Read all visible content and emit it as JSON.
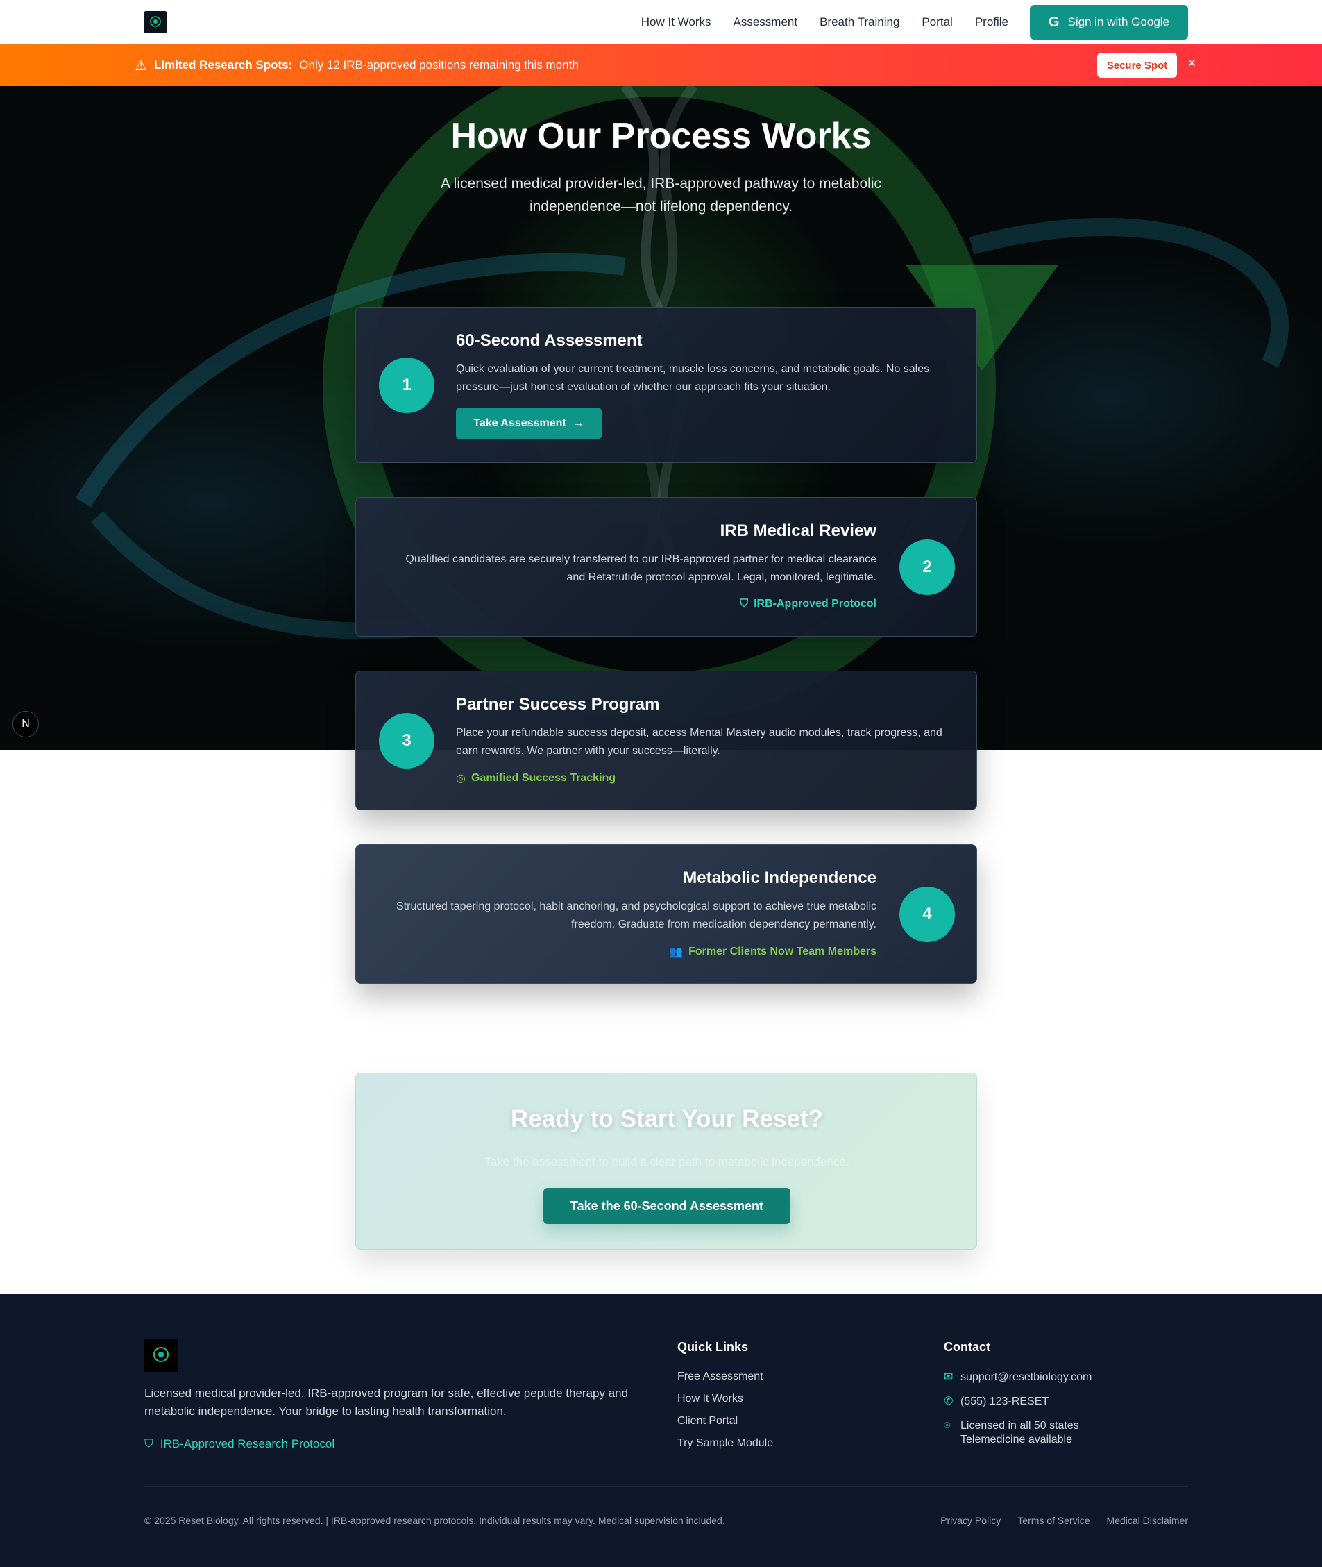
{
  "nav": {
    "links": [
      "How It Works",
      "Assessment",
      "Breath Training",
      "Portal",
      "Profile"
    ],
    "google_button": "Sign in with Google"
  },
  "banner": {
    "strong": "Limited Research Spots:",
    "text": "Only 12 IRB-approved positions remaining this month",
    "button": "Secure Spot",
    "close": "×"
  },
  "hero": {
    "title": "How Our Process Works",
    "subtitle": "A licensed medical provider-led, IRB-approved pathway to metabolic independence—not lifelong dependency."
  },
  "steps": [
    {
      "number": "1",
      "title": "60-Second Assessment",
      "description": "Quick evaluation of your current treatment, muscle loss concerns, and metabolic goals. No sales pressure—just honest evaluation of whether our approach fits your situation.",
      "button": "Take Assessment"
    },
    {
      "number": "2",
      "title": "IRB Medical Review",
      "description": "Qualified candidates are securely transferred to our IRB-approved partner for medical clearance and Retatrutide protocol approval. Legal, monitored, legitimate.",
      "tag": "IRB-Approved Protocol"
    },
    {
      "number": "3",
      "title": "Partner Success Program",
      "description": "Place your refundable success deposit, access Mental Mastery audio modules, track progress, and earn rewards. We partner with your success—literally.",
      "tag": "Gamified Success Tracking"
    },
    {
      "number": "4",
      "title": "Metabolic Independence",
      "description": "Structured tapering protocol, habit anchoring, and psychological support to achieve true metabolic freedom. Graduate from medication dependency permanently.",
      "tag": "Former Clients Now Team Members"
    }
  ],
  "cta": {
    "title": "Ready to Start Your Reset?",
    "subtitle": "Take the assessment to build a clear path to metabolic independence.",
    "button": "Take the 60-Second Assessment"
  },
  "footer": {
    "about": "Licensed medical provider-led, IRB-approved program for safe, effective peptide therapy and metabolic independence. Your bridge to lasting health transformation.",
    "irb": "IRB-Approved Research Protocol",
    "quick_links_heading": "Quick Links",
    "quick_links": [
      "Free Assessment",
      "How It Works",
      "Client Portal",
      "Try Sample Module"
    ],
    "contact_heading": "Contact",
    "email": "support@resetbiology.com",
    "phone": "(555) 123-RESET",
    "license_line1": "Licensed in all 50 states",
    "license_line2": "Telemedicine available",
    "copyright": "© 2025 Reset Biology. All rights reserved. | IRB-approved research protocols. Individual results may vary. Medical supervision included.",
    "legal": [
      "Privacy Policy",
      "Terms of Service",
      "Medical Disclaimer"
    ]
  },
  "colors": {
    "accent": "#14b8a6",
    "button": "#0f9488",
    "banner_start": "#ff7a00",
    "banner_end": "#ff2e3f",
    "tag_teal": "#2dd4bf",
    "tag_green": "#84cc4a",
    "footer_bg": "#0f172a"
  },
  "icons": {
    "banner": "warning-triangle-icon",
    "google": "google-icon",
    "step2": "shield-icon",
    "step3": "target-icon",
    "step4": "users-icon",
    "email": "mail-icon",
    "phone": "phone-icon",
    "location": "map-pin-icon"
  }
}
